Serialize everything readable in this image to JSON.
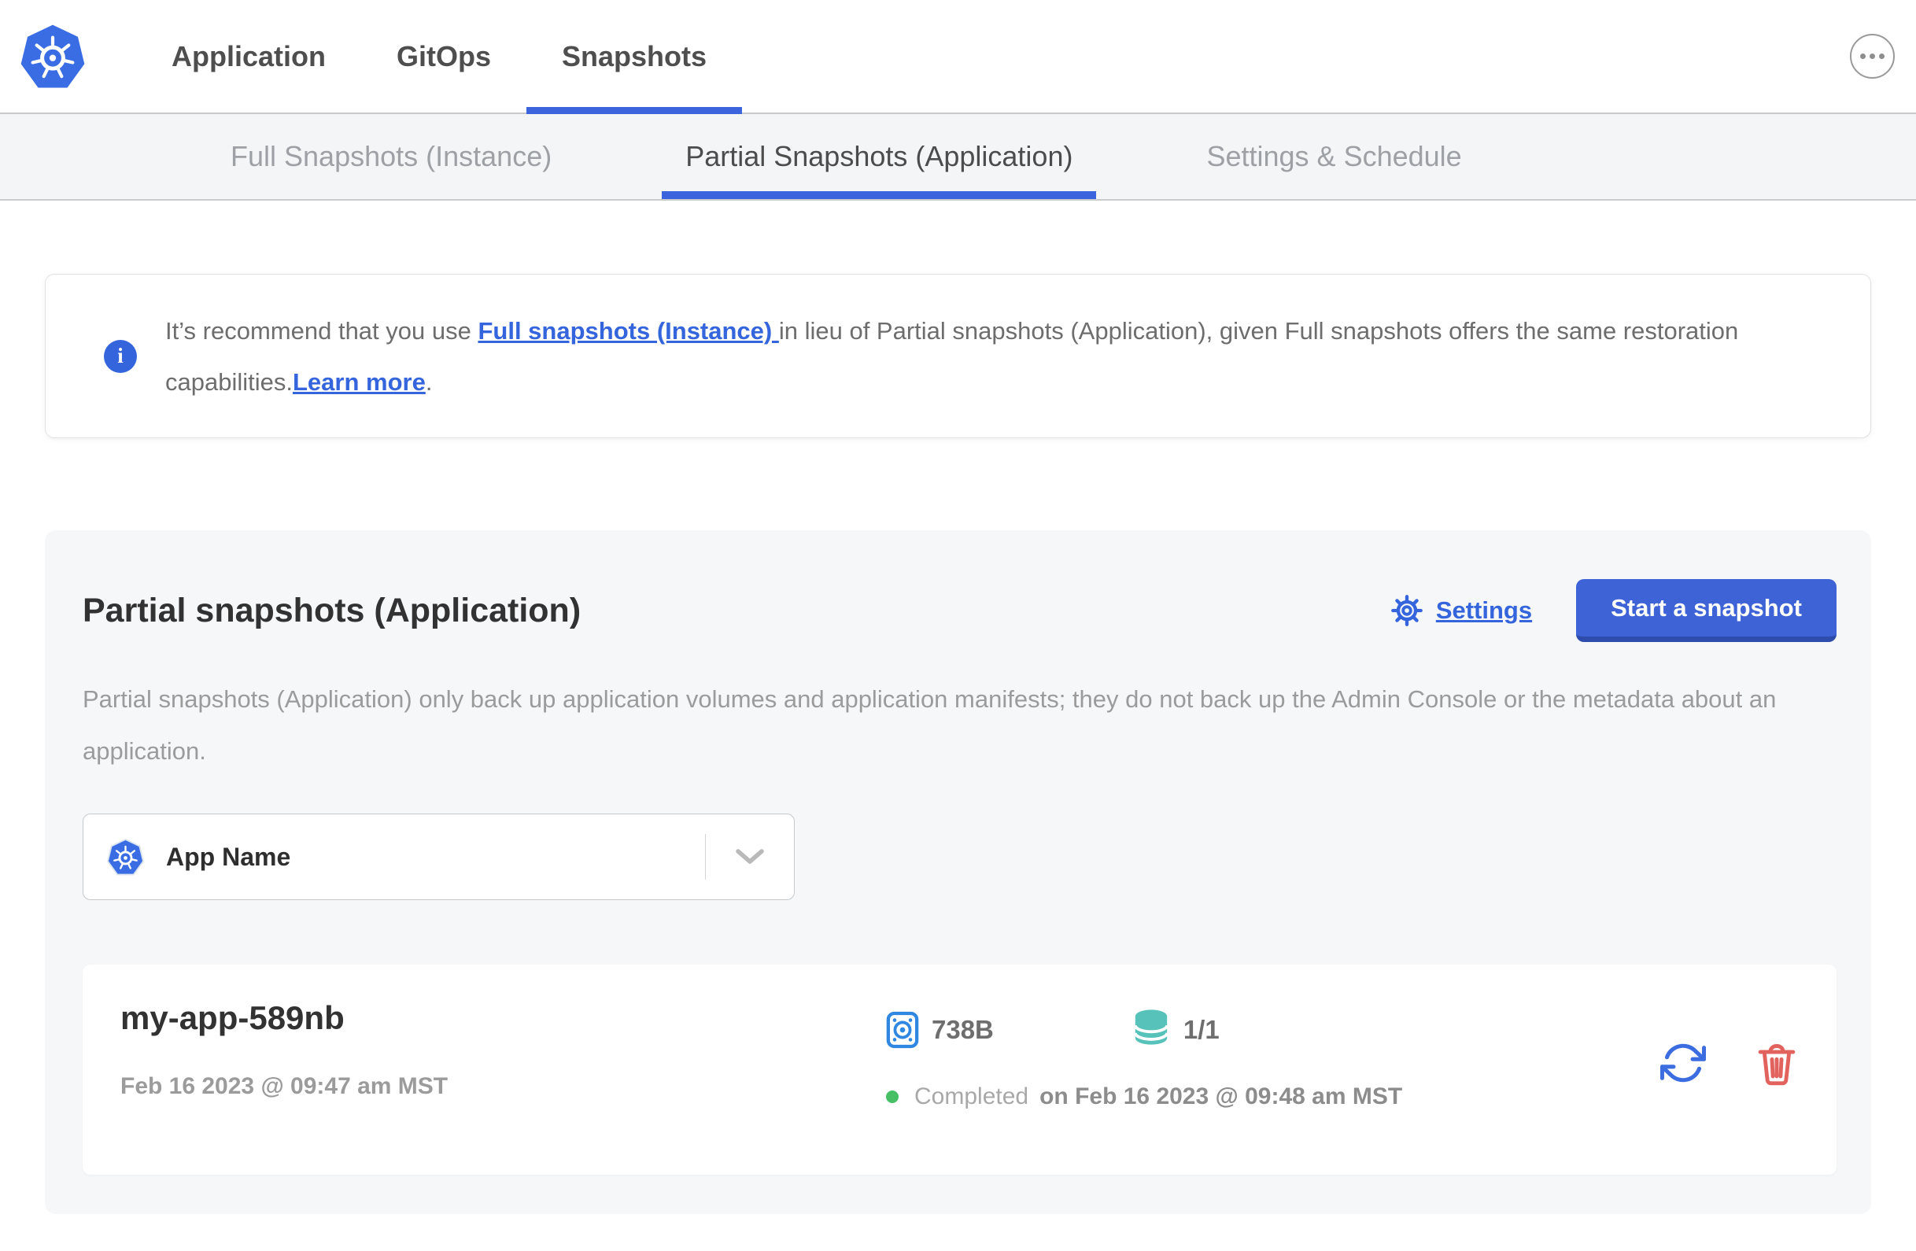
{
  "header": {
    "nav": [
      {
        "label": "Application",
        "active": false
      },
      {
        "label": "GitOps",
        "active": false
      },
      {
        "label": "Snapshots",
        "active": true
      }
    ]
  },
  "subnav": {
    "tabs": [
      {
        "label": "Full Snapshots (Instance)",
        "active": false
      },
      {
        "label": "Partial Snapshots (Application)",
        "active": true
      },
      {
        "label": "Settings & Schedule",
        "active": false
      }
    ]
  },
  "banner": {
    "text1": "It’s recommend that you use ",
    "link1": "Full snapshots (Instance) ",
    "text2": "in lieu of Partial snapshots (Application), given Full snapshots offers the same restoration capabilities.",
    "link2": "Learn more",
    "period": "."
  },
  "panel": {
    "title": "Partial snapshots (Application)",
    "settings_label": "Settings",
    "start_button_label": "Start a snapshot",
    "description": "Partial snapshots (Application) only back up application volumes and application manifests; they do not back up the Admin Console or the metadata about an application.",
    "app_selector": {
      "value": "App Name"
    },
    "snapshots": [
      {
        "name": "my-app-589nb",
        "started": "Feb 16 2023 @ 09:47 am MST",
        "size": "738B",
        "volumes": "1/1",
        "status": "Completed",
        "finished": "on Feb 16 2023 @ 09:48 am MST"
      }
    ]
  },
  "colors": {
    "accent_blue": "#3465dd",
    "button_blue": "#3e63d6",
    "tab_underline_blue": "#3b64dd",
    "volume_icon_blue": "#3087e2",
    "database_teal": "#56c2b9",
    "status_green": "#47c065",
    "delete_red": "#e2625e",
    "kubernetes_blue": "#3a6de4"
  }
}
